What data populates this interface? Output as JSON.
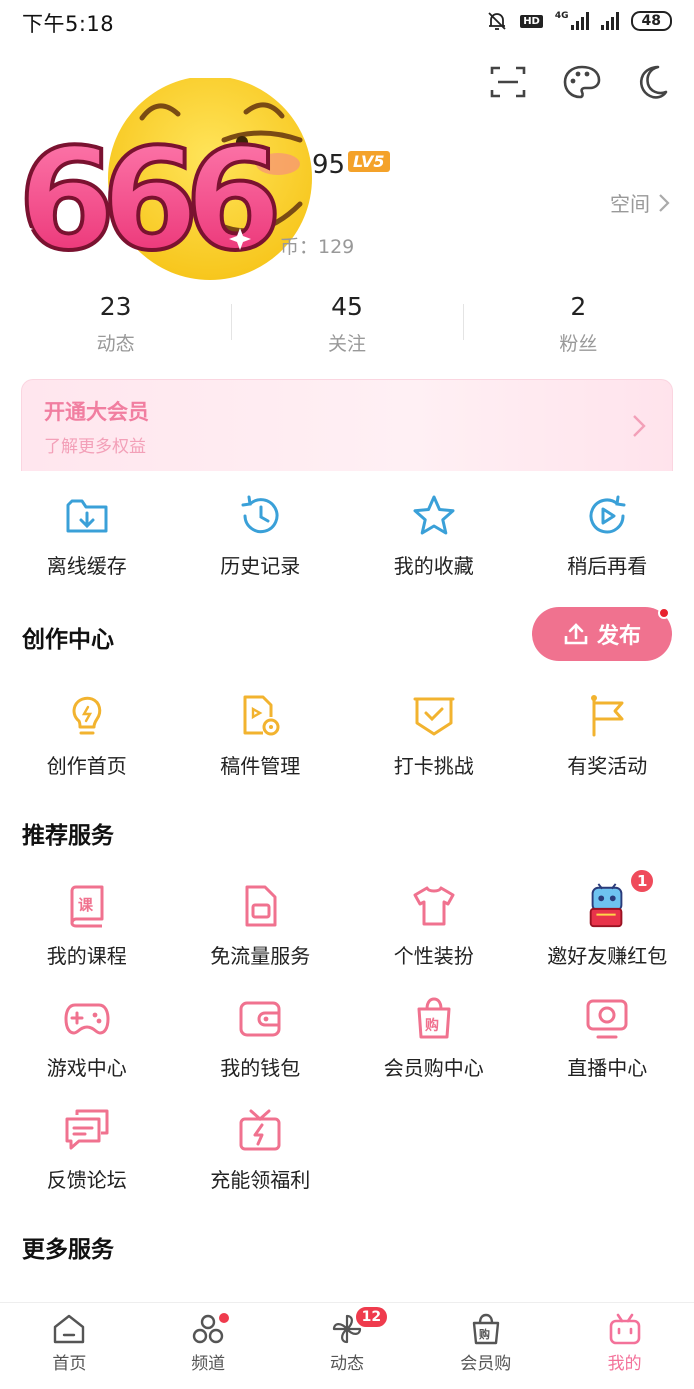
{
  "status_bar": {
    "time": "下午5:18",
    "network_label": "4G",
    "hd_label": "HD",
    "battery": "48"
  },
  "profile": {
    "sticker_text": "666",
    "level_number": "95",
    "level_badge": "LV5",
    "space_label": "空间",
    "coins_text": "币：129"
  },
  "stats": [
    {
      "value": "23",
      "label": "动态"
    },
    {
      "value": "45",
      "label": "关注"
    },
    {
      "value": "2",
      "label": "粉丝"
    }
  ],
  "vip": {
    "title": "开通大会员",
    "subtitle": "了解更多权益"
  },
  "quick_actions": [
    {
      "label": "离线缓存",
      "icon": "download-folder-icon"
    },
    {
      "label": "历史记录",
      "icon": "history-clock-icon"
    },
    {
      "label": "我的收藏",
      "icon": "star-icon"
    },
    {
      "label": "稍后再看",
      "icon": "play-later-icon"
    }
  ],
  "creation": {
    "title": "创作中心",
    "publish_label": "发布",
    "items": [
      {
        "label": "创作首页",
        "icon": "lightbulb-icon"
      },
      {
        "label": "稿件管理",
        "icon": "manuscript-icon"
      },
      {
        "label": "打卡挑战",
        "icon": "checkin-badge-icon"
      },
      {
        "label": "有奖活动",
        "icon": "flag-icon"
      }
    ]
  },
  "recommended": {
    "title": "推荐服务",
    "rows": [
      [
        {
          "label": "我的课程",
          "icon": "course-book-icon"
        },
        {
          "label": "免流量服务",
          "icon": "sim-card-icon"
        },
        {
          "label": "个性装扮",
          "icon": "tshirt-icon"
        },
        {
          "label": "邀好友赚红包",
          "icon": "invite-robot-icon",
          "badge": "1"
        }
      ],
      [
        {
          "label": "游戏中心",
          "icon": "gamepad-icon"
        },
        {
          "label": "我的钱包",
          "icon": "wallet-icon"
        },
        {
          "label": "会员购中心",
          "icon": "shopping-bag-icon"
        },
        {
          "label": "直播中心",
          "icon": "live-tv-icon"
        }
      ],
      [
        {
          "label": "反馈论坛",
          "icon": "feedback-chat-icon"
        },
        {
          "label": "充能领福利",
          "icon": "gift-charge-icon"
        }
      ]
    ]
  },
  "more_services": {
    "title": "更多服务"
  },
  "bottom_nav": [
    {
      "label": "首页",
      "icon": "home-icon"
    },
    {
      "label": "频道",
      "icon": "channel-icon",
      "dot": true
    },
    {
      "label": "动态",
      "icon": "pinwheel-icon",
      "count": "12"
    },
    {
      "label": "会员购",
      "icon": "shop-bag-icon"
    },
    {
      "label": "我的",
      "icon": "tv-mascot-icon",
      "active": true
    }
  ],
  "colors": {
    "pink": "#f0728f",
    "blue": "#3aa0d8",
    "gold": "#f2b32f"
  }
}
